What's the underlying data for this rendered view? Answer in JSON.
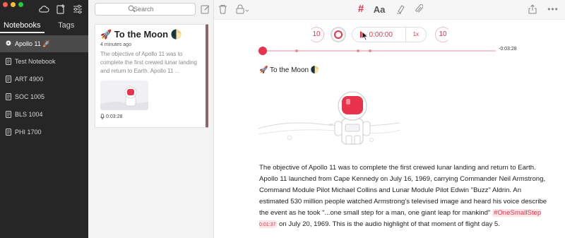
{
  "sidebar": {
    "tabs": [
      {
        "label": "Notebooks",
        "active": true
      },
      {
        "label": "Tags",
        "active": false
      }
    ],
    "notebooks": [
      {
        "label": "Apollo 11 🚀",
        "selected": true
      },
      {
        "label": "Test Notebook",
        "selected": false
      },
      {
        "label": "ART 4900",
        "selected": false
      },
      {
        "label": "SOC 1005",
        "selected": false
      },
      {
        "label": "BLS 1004",
        "selected": false
      },
      {
        "label": "PHI 1700",
        "selected": false
      }
    ]
  },
  "search": {
    "placeholder": "Search"
  },
  "note_card": {
    "title": "🚀 To the Moon 🌓",
    "time": "4 minutes ago",
    "snippet": "The objective of Apollo 11 was to complete the first crewed lunar landing and return to Earth. Apollo 11 ...",
    "audio_duration": "0:03:28"
  },
  "toolbar": {
    "icons": [
      "compose-icon",
      "trash-icon",
      "lock-icon",
      "hashtag-icon",
      "font-icon",
      "highlighter-icon",
      "attachment-icon",
      "share-icon",
      "more-icon"
    ]
  },
  "player": {
    "back_label": "10",
    "forward_label": "10",
    "time": "0:00:00",
    "speed": "1x",
    "remaining": "-0:03:28",
    "progress": 0.0
  },
  "note": {
    "title": "🚀 To the Moon 🌓",
    "body_before_tag": "The objective of Apollo 11 was to complete the first crewed lunar landing and return to Earth. Apollo 11 launched from Cape Kennedy on July 16, 1969, carrying Commander Neil Armstrong, Command Module Pilot Michael Collins and Lunar Module Pilot Edwin \"Buzz\" Aldrin. An estimated 530 million people watched Armstrong's televised image and heard his voice describe the event as he took \"...one small step for a man, one giant leap for mankind\" ",
    "tag_label": "#OneSmallStep",
    "tag_time": "0:01:37",
    "body_after_tag": " on July 20, 1969. This is the audio highlight of that moment of flight day 5."
  },
  "colors": {
    "accent": "#e8334d",
    "sidebar_bg": "#262626",
    "selected_bg": "#4b4b4b"
  }
}
